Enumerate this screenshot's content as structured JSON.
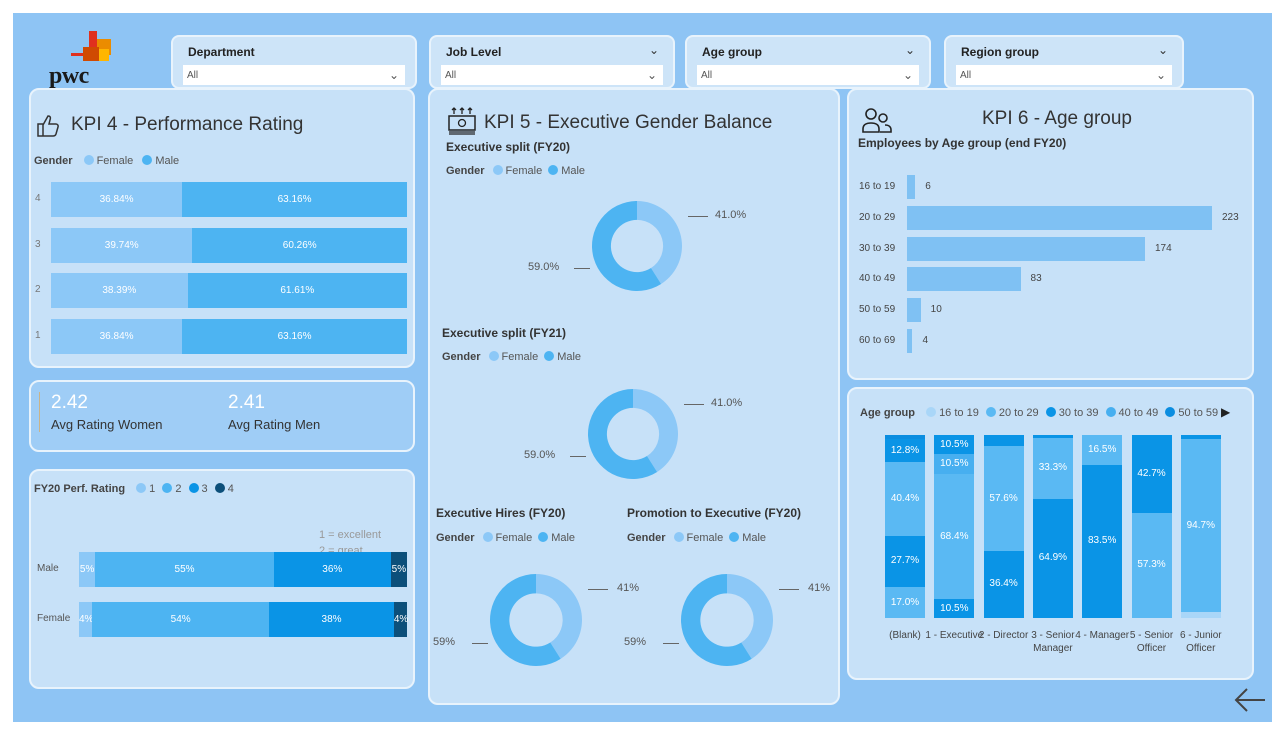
{
  "brand": {
    "logo_text": "pwc"
  },
  "slicers": [
    {
      "label": "Department",
      "value": "All"
    },
    {
      "label": "Job Level",
      "value": "All"
    },
    {
      "label": "Age group",
      "value": "All"
    },
    {
      "label": "Region group",
      "value": "All"
    }
  ],
  "kpi4": {
    "title": "KPI 4 - Performance Rating",
    "legend_title": "Gender",
    "legend": [
      "Female",
      "Male"
    ],
    "rows": [
      {
        "label": "4",
        "female": "36.84%",
        "male": "63.16%",
        "f": 36.84
      },
      {
        "label": "3",
        "female": "39.74%",
        "male": "60.26%",
        "f": 39.74
      },
      {
        "label": "2",
        "female": "38.39%",
        "male": "61.61%",
        "f": 38.39
      },
      {
        "label": "1",
        "female": "36.84%",
        "male": "63.16%",
        "f": 36.84
      }
    ]
  },
  "avg": {
    "women_value": "2.42",
    "women_label": "Avg Rating Women",
    "men_value": "2.41",
    "men_label": "Avg Rating Men"
  },
  "fy20": {
    "legend_title": "FY20 Perf. Rating",
    "legend": [
      "1",
      "2",
      "3",
      "4"
    ],
    "note1": "1 = excellent",
    "note2": "2 = great",
    "rows": [
      {
        "label": "Male",
        "segs": [
          {
            "t": "5%",
            "v": 5
          },
          {
            "t": "55%",
            "v": 55
          },
          {
            "t": "36%",
            "v": 36
          },
          {
            "t": "5%",
            "v": 5
          }
        ]
      },
      {
        "label": "Female",
        "segs": [
          {
            "t": "4%",
            "v": 4
          },
          {
            "t": "54%",
            "v": 54
          },
          {
            "t": "38%",
            "v": 38
          },
          {
            "t": "4%",
            "v": 4
          }
        ]
      }
    ]
  },
  "kpi5": {
    "title": "KPI 5 - Executive Gender Balance",
    "legend_title": "Gender",
    "legend": [
      "Female",
      "Male"
    ],
    "donuts": [
      {
        "title": "Executive split (FY20)",
        "female_pct": "41.0%",
        "male_pct": "59.0%",
        "female": 41
      },
      {
        "title": "Executive split (FY21)",
        "female_pct": "41.0%",
        "male_pct": "59.0%",
        "female": 41
      },
      {
        "title": "Executive Hires (FY20)",
        "female_pct": "41%",
        "male_pct": "59%",
        "female": 41
      },
      {
        "title": "Promotion to Executive (FY20)",
        "female_pct": "41%",
        "male_pct": "59%",
        "female": 41
      }
    ]
  },
  "kpi6": {
    "title": "KPI 6 - Age group",
    "subtitle": "Employees by Age group (end FY20)",
    "bars": [
      {
        "label": "16 to 19",
        "value": 6
      },
      {
        "label": "20 to 29",
        "value": 223
      },
      {
        "label": "30 to 39",
        "value": 174
      },
      {
        "label": "40 to 49",
        "value": 83
      },
      {
        "label": "50 to 59",
        "value": 10
      },
      {
        "label": "60 to 69",
        "value": 4
      }
    ]
  },
  "stacked": {
    "legend_title": "Age group",
    "legend": [
      "16 to 19",
      "20 to 29",
      "30 to 39",
      "40 to 49",
      "50 to 59"
    ],
    "columns": [
      {
        "label": "(Blank)",
        "segs": [
          {
            "v": 17.0,
            "c": 1,
            "t": "17.0%"
          },
          {
            "v": 27.7,
            "c": 2,
            "t": "27.7%"
          },
          {
            "v": 40.4,
            "c": 1,
            "t": "40.4%"
          },
          {
            "v": 12.8,
            "c": 2,
            "t": "12.8%"
          },
          {
            "v": 2.1,
            "c": 4,
            "t": ""
          }
        ]
      },
      {
        "label": "1 - Executive",
        "segs": [
          {
            "v": 10.5,
            "c": 2,
            "t": "10.5%"
          },
          {
            "v": 68.4,
            "c": 1,
            "t": "68.4%"
          },
          {
            "v": 10.5,
            "c": 3,
            "t": "10.5%"
          },
          {
            "v": 10.5,
            "c": 2,
            "t": "10.5%"
          }
        ]
      },
      {
        "label": "2 - Director",
        "segs": [
          {
            "v": 36.4,
            "c": 2,
            "t": "36.4%"
          },
          {
            "v": 57.6,
            "c": 1,
            "t": "57.6%"
          },
          {
            "v": 6.0,
            "c": 2,
            "t": ""
          }
        ]
      },
      {
        "label": "3 - Senior Manager",
        "segs": [
          {
            "v": 64.9,
            "c": 2,
            "t": "64.9%"
          },
          {
            "v": 33.3,
            "c": 1,
            "t": "33.3%"
          },
          {
            "v": 1.8,
            "c": 2,
            "t": ""
          }
        ]
      },
      {
        "label": "4 - Manager",
        "segs": [
          {
            "v": 83.5,
            "c": 2,
            "t": "83.5%"
          },
          {
            "v": 16.5,
            "c": 1,
            "t": "16.5%"
          }
        ]
      },
      {
        "label": "5 - Senior Officer",
        "segs": [
          {
            "v": 57.3,
            "c": 1,
            "t": "57.3%"
          },
          {
            "v": 42.7,
            "c": 2,
            "t": "42.7%"
          }
        ]
      },
      {
        "label": "6 - Junior Officer",
        "segs": [
          {
            "v": 3.2,
            "c": 0,
            "t": ""
          },
          {
            "v": 94.7,
            "c": 1,
            "t": "94.7%"
          },
          {
            "v": 2.1,
            "c": 2,
            "t": ""
          }
        ]
      }
    ]
  },
  "colors": {
    "female": "#8cc8f7",
    "male": "#4db4f2",
    "r1": "#8cc8f7",
    "r2": "#4db4f2",
    "r3": "#0a94e6",
    "r4": "#0c4f7a",
    "age": [
      "#a9d6f8",
      "#5ab9f3",
      "#0a94e6",
      "#47aff0",
      "#0b8de0"
    ]
  }
}
